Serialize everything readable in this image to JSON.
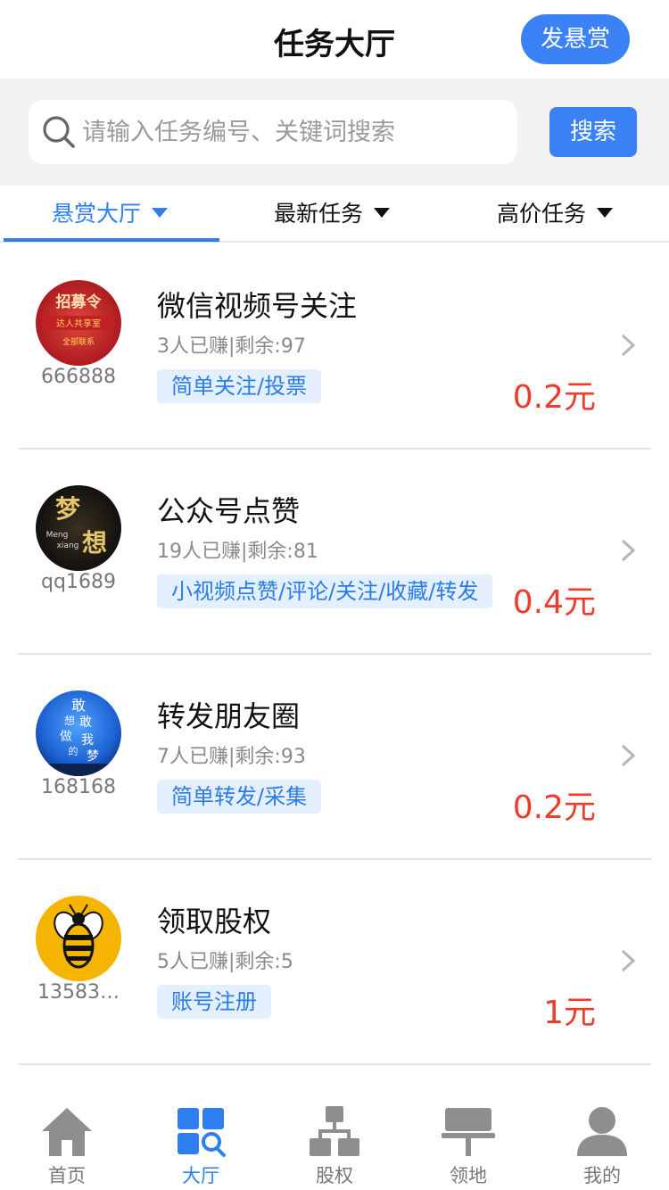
{
  "header": {
    "title": "任务大厅",
    "post_button": "发悬赏"
  },
  "search": {
    "placeholder": "请输入任务编号、关键词搜索",
    "button": "搜索"
  },
  "tabs": [
    {
      "label": "悬赏大厅",
      "active": true
    },
    {
      "label": "最新任务",
      "active": false
    },
    {
      "label": "高价任务",
      "active": false
    }
  ],
  "tasks": [
    {
      "owner": "666888",
      "title": "微信视频号关注",
      "stats": "3人已赚|剩余:97",
      "tag": "简单关注/投票",
      "price": "0.2元",
      "avatar_text": [
        "招募令",
        "达人共享室",
        "全部联系"
      ]
    },
    {
      "owner": "qq1689",
      "title": "公众号点赞",
      "stats": "19人已赚|剩余:81",
      "tag": "小视频点赞/评论/关注/收藏/转发",
      "price": "0.4元",
      "avatar_text": [
        "梦",
        "想",
        "Meng",
        "xiang"
      ]
    },
    {
      "owner": "168168",
      "title": "转发朋友圈",
      "stats": "7人已赚|剩余:93",
      "tag": "简单转发/采集",
      "price": "0.2元",
      "avatar_text": [
        "敢",
        "想",
        "敢",
        "做",
        "我",
        "的",
        "梦"
      ]
    },
    {
      "owner": "13583…",
      "title": "领取股权",
      "stats": "5人已赚|剩余:5",
      "tag": "账号注册",
      "price": "1元"
    }
  ],
  "nav": [
    {
      "label": "首页",
      "icon": "home-icon",
      "active": false
    },
    {
      "label": "大厅",
      "icon": "hall-icon",
      "active": true
    },
    {
      "label": "股权",
      "icon": "equity-icon",
      "active": false
    },
    {
      "label": "领地",
      "icon": "territory-icon",
      "active": false
    },
    {
      "label": "我的",
      "icon": "profile-icon",
      "active": false
    }
  ],
  "colors": {
    "accent": "#3a82f6",
    "price": "#ef3b2c",
    "tag_bg": "#e4f0fd",
    "tag_text": "#2b7be8"
  }
}
